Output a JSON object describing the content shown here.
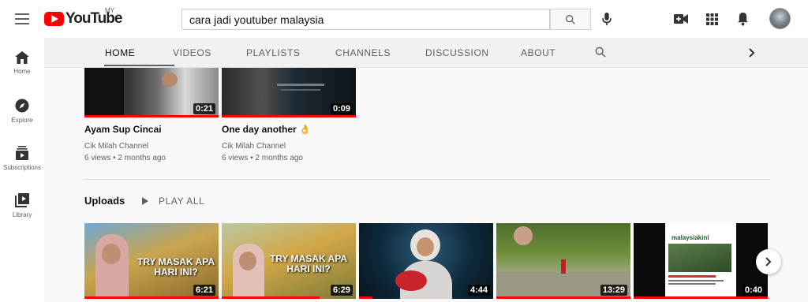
{
  "header": {
    "logo_text": "YouTube",
    "country_code": "MY",
    "search_value": "cara jadi youtuber malaysia",
    "icons": [
      "menu-icon",
      "search-icon",
      "mic-icon",
      "create-video-icon",
      "apps-icon",
      "bell-icon",
      "avatar"
    ]
  },
  "sidebar": {
    "items": [
      {
        "label": "Home",
        "icon": "home-icon"
      },
      {
        "label": "Explore",
        "icon": "compass-icon"
      },
      {
        "label": "Subscriptions",
        "icon": "subscriptions-icon"
      },
      {
        "label": "Library",
        "icon": "library-icon"
      }
    ]
  },
  "tabs": [
    {
      "label": "HOME",
      "active": true
    },
    {
      "label": "VIDEOS"
    },
    {
      "label": "PLAYLISTS"
    },
    {
      "label": "CHANNELS"
    },
    {
      "label": "DISCUSSION"
    },
    {
      "label": "ABOUT"
    }
  ],
  "top_videos": [
    {
      "title": "Ayam Sup Cincai",
      "channel": "Cik Milah Channel",
      "meta": "6 views • 2 months ago",
      "duration": "0:21",
      "watched": 1.0
    },
    {
      "title": "One day another 👌",
      "channel": "Cik Milah Channel",
      "meta": "6 views • 2 months ago",
      "duration": "0:09",
      "watched": 1.0
    }
  ],
  "uploads": {
    "heading": "Uploads",
    "play_all": "PLAY ALL",
    "videos": [
      {
        "duration": "6:21",
        "watched": 1.0,
        "overlay": "TRY MASAK APA HARI INI?"
      },
      {
        "duration": "6:29",
        "watched": 0.73,
        "overlay": "TRY MASAK APA HARI INI?"
      },
      {
        "duration": "4:44",
        "watched": 0.1,
        "overlay": ""
      },
      {
        "duration": "13:29",
        "watched": 1.0,
        "overlay": ""
      },
      {
        "duration": "0:40",
        "watched": 1.0,
        "overlay": "malaysiakini"
      }
    ]
  },
  "colors": {
    "accent": "#ff0000",
    "tabs_bg": "#f1f1f1"
  }
}
